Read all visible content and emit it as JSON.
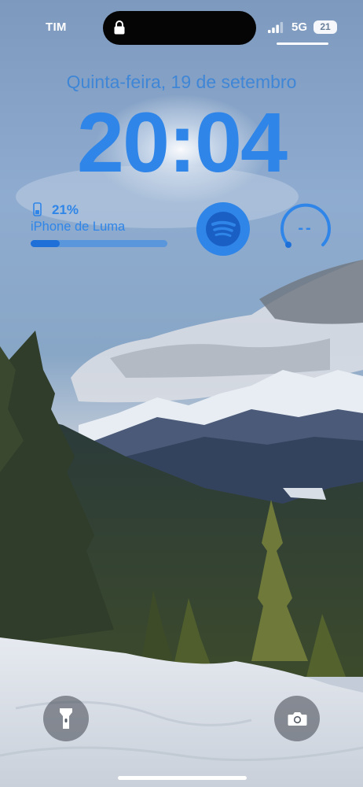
{
  "status_bar": {
    "carrier": "TIM",
    "network": "5G",
    "battery_level": "21",
    "lock_icon": "lock-icon",
    "signal_icon": "cellular-signal-icon"
  },
  "lock_screen": {
    "date": "Quinta-feira, 19 de setembro",
    "time": "20:04"
  },
  "widgets": {
    "battery": {
      "icon": "iphone-icon",
      "percent": "21%",
      "device_name": "iPhone de Luma",
      "level_fraction": 0.21
    },
    "spotify": {
      "icon": "spotify-icon"
    },
    "gauge": {
      "value": "--"
    }
  },
  "bottom_controls": {
    "flashlight_icon": "flashlight-icon",
    "camera_icon": "camera-icon"
  },
  "colors": {
    "accent_blue": "#2f85e8",
    "date_blue": "#3f86d6"
  }
}
